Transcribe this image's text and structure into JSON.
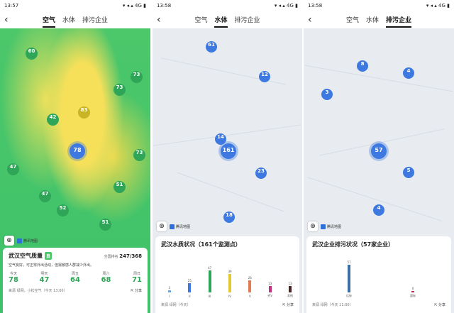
{
  "panels": [
    {
      "status": {
        "time": "13:57",
        "icons": "▾ ◂ ▴ 4G ▮"
      },
      "tabs": [
        "空气",
        "水体",
        "排污企业"
      ],
      "active": 0
    },
    {
      "status": {
        "time": "13:58",
        "icons": "▾ ◂ ▴ 4G ▮"
      },
      "tabs": [
        "空气",
        "水体",
        "排污企业"
      ],
      "active": 1
    },
    {
      "status": {
        "time": "13:58",
        "icons": "▾ ◂ ▴ 4G ▮"
      },
      "tabs": [
        "空气",
        "水体",
        "排污企业"
      ],
      "active": 2
    }
  ],
  "air": {
    "markers": [
      [
        "武汉",
        "78",
        "big"
      ],
      [
        "黄陂",
        "60",
        "g"
      ],
      [
        "新洲",
        "73",
        "g"
      ],
      [
        "汉南",
        "42",
        "g"
      ],
      [
        "蔡甸",
        "47",
        "g"
      ],
      [
        "江夏",
        "51",
        "g"
      ],
      [
        "孝感",
        "83",
        "y"
      ],
      [
        "黄冈",
        "73",
        "g"
      ],
      [
        "鄂州",
        "73",
        "g"
      ],
      [
        "咸宁",
        "51",
        "g"
      ],
      [
        "黄石",
        "52",
        "g"
      ],
      [
        "仙桃",
        "47",
        "g"
      ]
    ],
    "brand": "腾讯地图",
    "card": {
      "title": "武汉空气质量",
      "badge": "良",
      "rank_label": "全国排名",
      "rank": "247/368",
      "desc": "空气良好，可正常外出活动，但需敏感人群减少外出。",
      "forecast": [
        {
          "day": "今天",
          "aqi": "78"
        },
        {
          "day": "明天",
          "aqi": "47"
        },
        {
          "day": "周五",
          "aqi": "64"
        },
        {
          "day": "周六",
          "aqi": "68"
        },
        {
          "day": "周日",
          "aqi": "71"
        }
      ],
      "source": "来源 绿网，小松空气（今天 13:00）",
      "share": "分享"
    }
  },
  "water": {
    "markers": [
      [
        "孝感",
        "61",
        "b"
      ],
      [
        "武汉",
        "161",
        "big"
      ],
      [
        "鄂州",
        "23",
        "b"
      ],
      [
        "黄冈",
        "14",
        "b"
      ],
      [
        "黄石",
        "18",
        "b"
      ],
      [
        "咸宁",
        "12",
        "b"
      ]
    ],
    "brand": "腾讯地图",
    "card": {
      "title": "武汉水质状况（161个监测点）",
      "chart": [
        {
          "label": "I",
          "count": "3",
          "pct": 6,
          "color": "#6aa8e8"
        },
        {
          "label": "II",
          "count": "25",
          "pct": 30,
          "color": "#3d79e0"
        },
        {
          "label": "III",
          "count": "47",
          "pct": 70,
          "color": "#2ea557"
        },
        {
          "label": "IV",
          "count": "39",
          "pct": 58,
          "color": "#e2c934"
        },
        {
          "label": "V",
          "count": "26",
          "pct": 38,
          "color": "#e27a52"
        },
        {
          "label": "劣V",
          "count": "13",
          "pct": 20,
          "color": "#c0337f"
        },
        {
          "label": "其他",
          "count": "13",
          "pct": 20,
          "color": "#4a2424"
        }
      ],
      "source": "来源 绿网（今天）",
      "share": "分享"
    }
  },
  "enterprise": {
    "markers": [
      [
        "孝感",
        "8",
        "b"
      ],
      [
        "麻城",
        "3",
        "b"
      ],
      [
        "团风",
        "4",
        "b"
      ],
      [
        "武汉",
        "57",
        "big"
      ],
      [
        "鄂州",
        "5",
        "b"
      ],
      [
        "黄石",
        "4",
        "b"
      ]
    ],
    "brand": "腾讯地图",
    "card": {
      "title": "武汉企业排污状况（57家企业）",
      "chart": [
        {
          "label": "达标",
          "count": "57",
          "pct": 88,
          "color": "#3a6ea5"
        },
        {
          "label": "超标",
          "count": "0",
          "pct": 2,
          "color": "#b0334c"
        }
      ],
      "source": "来源 绿网（今天 11:00）",
      "share": "分享"
    }
  }
}
